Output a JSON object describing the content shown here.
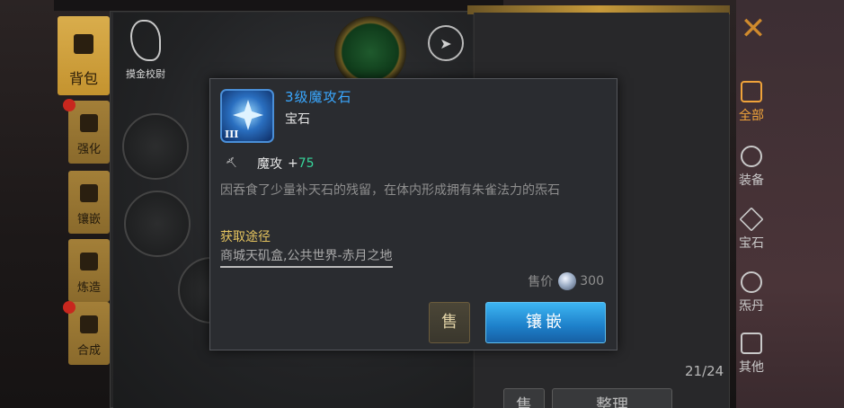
{
  "left_tabs": [
    {
      "label": "背包",
      "active": true
    },
    {
      "label": "强化",
      "badge": true
    },
    {
      "label": "镶嵌",
      "badge": false
    },
    {
      "label": "炼造",
      "badge": false
    },
    {
      "label": "合成",
      "badge": true
    }
  ],
  "character": {
    "logo_text": "摸金校尉"
  },
  "right_nav": [
    {
      "label": "全部",
      "icon": "grid-icon",
      "active": true
    },
    {
      "label": "装备",
      "icon": "shield-icon"
    },
    {
      "label": "宝石",
      "icon": "gem-icon"
    },
    {
      "label": "炁丹",
      "icon": "swirl-icon"
    },
    {
      "label": "其他",
      "icon": "list-icon"
    }
  ],
  "inventory": {
    "count": "21/24",
    "sell_label": "售",
    "sort_label": "整理"
  },
  "tooltip": {
    "item_name": "3级魔攻石",
    "tier_numeral": "III",
    "item_type": "宝石",
    "stat_name": "魔攻",
    "stat_plus": "+",
    "stat_value": "75",
    "description": "因吞食了少量补天石的残留，在体内形成拥有朱雀法力的炁石",
    "source_title": "获取途径",
    "source_text": "商城天矶盒,公共世界-赤月之地",
    "price_label": "售价",
    "price_value": "300",
    "sell_button": "售",
    "inlay_button": "镶嵌"
  },
  "colors": {
    "item_name": "#3aa8ff",
    "stat_value": "#37d49a",
    "source_title": "#e5c45e",
    "active_nav": "#f0a33a",
    "close": "#cf8a2d"
  }
}
